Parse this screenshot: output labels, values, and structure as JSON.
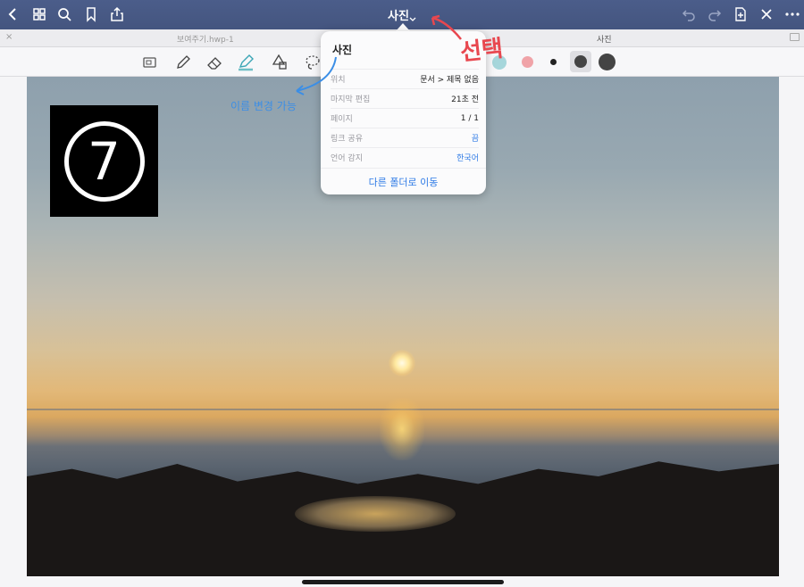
{
  "navbar": {
    "title": "사진",
    "icons": [
      "back-icon",
      "grid-icon",
      "search-icon",
      "bookmark-icon",
      "share-icon",
      "undo-icon",
      "redo-icon",
      "add-page-icon",
      "close-icon",
      "more-icon"
    ]
  },
  "tabs": {
    "left_tab": "보여주기.hwp-1",
    "right_tab": "사진"
  },
  "tools": [
    "document-icon",
    "pen-icon",
    "eraser-icon",
    "highlighter-icon",
    "shapes-icon",
    "lasso-icon"
  ],
  "colors": {
    "nav_bg": "#485a86",
    "accent_blue": "#2f7be6",
    "annotation_red": "#e8474f",
    "annotation_blue": "#3b8ee6",
    "swatch_pink": "#f0a3a8",
    "swatch_teal": "#6fbfc6"
  },
  "popover": {
    "title": "사진",
    "rows": [
      {
        "key": "위치",
        "value": "문서 > 제목 없음"
      },
      {
        "key": "마지막 편집",
        "value": "21초 전"
      },
      {
        "key": "페이지",
        "value": "1 / 1"
      },
      {
        "key": "링크 공유",
        "value": "끔"
      },
      {
        "key": "언어 감지",
        "value": "한국어"
      }
    ],
    "action": "다른 폴더로 이동"
  },
  "annotations": {
    "select_label": "선택",
    "rename_label": "이름 변경 가능"
  },
  "badge": {
    "number": "7"
  }
}
